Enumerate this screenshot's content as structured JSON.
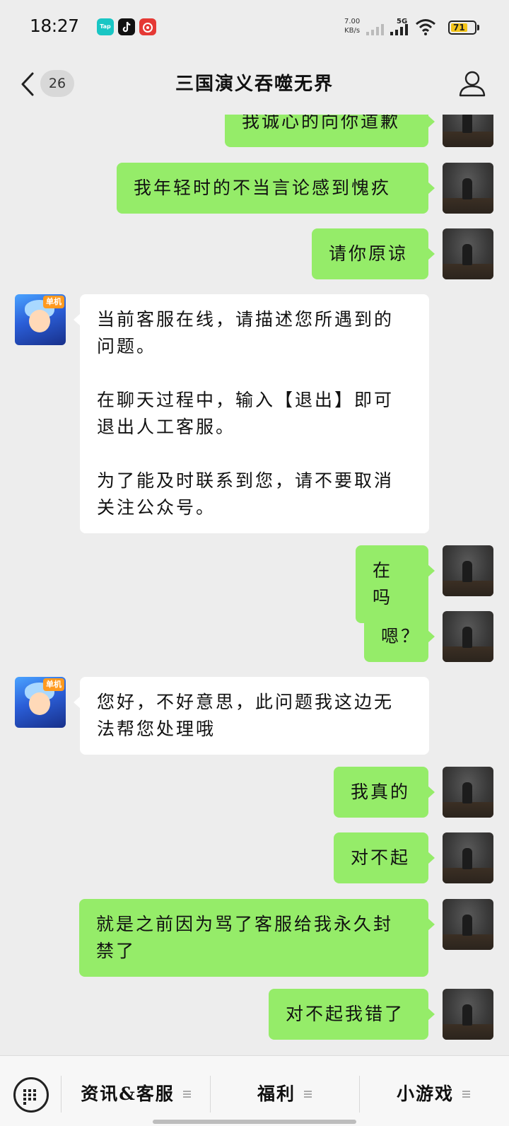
{
  "status_bar": {
    "time": "18:27",
    "apps": [
      "TapTap",
      "TikTok",
      "NetEase Music"
    ],
    "net_speed": "7.00",
    "net_unit": "KB/s",
    "network": "5G",
    "battery": "71",
    "battery_level": 0.71
  },
  "header": {
    "unread_count": "26",
    "title": "三国演义吞噬无界"
  },
  "messages": [
    {
      "from": "me",
      "text": "我诚心的向你道歉"
    },
    {
      "from": "me",
      "text": "我年轻时的不当言论感到愧疚"
    },
    {
      "from": "me",
      "text": "请你原谅"
    },
    {
      "from": "bot",
      "text": "当前客服在线，请描述您所遇到的问题。\n\n在聊天过程中，输入【退出】即可退出人工客服。\n\n为了能及时联系到您，请不要取消关注公众号。"
    },
    {
      "from": "me",
      "text": "在吗"
    },
    {
      "from": "me",
      "text": "嗯？"
    },
    {
      "from": "bot",
      "text": "您好，不好意思，此问题我这边无法帮您处理哦"
    },
    {
      "from": "me",
      "text": "我真的"
    },
    {
      "from": "me",
      "text": "对不起"
    },
    {
      "from": "me",
      "text": "就是之前因为骂了客服给我永久封禁了"
    },
    {
      "from": "me",
      "text": "对不起我错了"
    }
  ],
  "bot_avatar_tag": "单机",
  "bottom_menu": [
    {
      "label": "资讯&客服"
    },
    {
      "label": "福利"
    },
    {
      "label": "小游戏"
    }
  ],
  "icons": {
    "back": "chevron-left-icon",
    "profile": "person-icon",
    "keyboard": "keyboard-icon",
    "menu": "menu-lines-icon"
  },
  "colors": {
    "background": "#ededed",
    "outgoing_bubble": "#95ec69",
    "incoming_bubble": "#ffffff"
  }
}
